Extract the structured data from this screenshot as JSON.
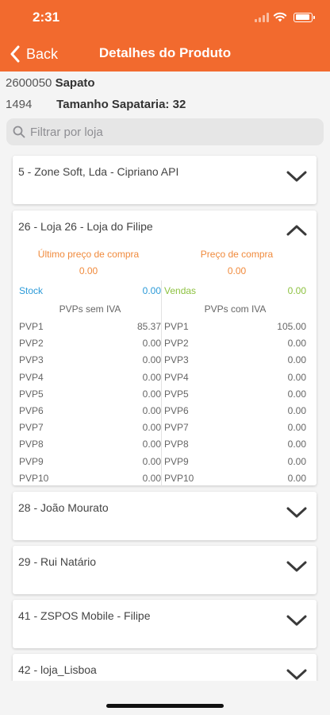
{
  "status": {
    "time": "2:31"
  },
  "nav": {
    "back_label": "Back",
    "title": "Detalhes do Produto"
  },
  "product": {
    "code": "2600050",
    "name": "Sapato",
    "size_code": "1494",
    "size_label": "Tamanho Sapataria: 32"
  },
  "search": {
    "placeholder": "Filtrar por loja"
  },
  "stores": [
    {
      "label": "5 - Zone Soft, Lda - Cipriano API",
      "expanded": false
    },
    {
      "label": "26 - Loja 26 - Loja do Filipe",
      "expanded": true,
      "ultimo_preco_label": "Último preço de compra",
      "ultimo_preco_value": "0.00",
      "preco_compra_label": "Preço de compra",
      "preco_compra_value": "0.00",
      "stock_label": "Stock",
      "stock_value": "0.00",
      "vendas_label": "Vendas",
      "vendas_value": "0.00",
      "pvp_sem_iva_title": "PVPs sem IVA",
      "pvp_com_iva_title": "PVPs com IVA",
      "pvp_sem_iva": [
        {
          "label": "PVP1",
          "value": "85.37"
        },
        {
          "label": "PVP2",
          "value": "0.00"
        },
        {
          "label": "PVP3",
          "value": "0.00"
        },
        {
          "label": "PVP4",
          "value": "0.00"
        },
        {
          "label": "PVP5",
          "value": "0.00"
        },
        {
          "label": "PVP6",
          "value": "0.00"
        },
        {
          "label": "PVP7",
          "value": "0.00"
        },
        {
          "label": "PVP8",
          "value": "0.00"
        },
        {
          "label": "PVP9",
          "value": "0.00"
        },
        {
          "label": "PVP10",
          "value": "0.00"
        }
      ],
      "pvp_com_iva": [
        {
          "label": "PVP1",
          "value": "105.00"
        },
        {
          "label": "PVP2",
          "value": "0.00"
        },
        {
          "label": "PVP3",
          "value": "0.00"
        },
        {
          "label": "PVP4",
          "value": "0.00"
        },
        {
          "label": "PVP5",
          "value": "0.00"
        },
        {
          "label": "PVP6",
          "value": "0.00"
        },
        {
          "label": "PVP7",
          "value": "0.00"
        },
        {
          "label": "PVP8",
          "value": "0.00"
        },
        {
          "label": "PVP9",
          "value": "0.00"
        },
        {
          "label": "PVP10",
          "value": "0.00"
        }
      ]
    },
    {
      "label": "28 - João Mourato",
      "expanded": false
    },
    {
      "label": "29 - Rui Natário",
      "expanded": false
    },
    {
      "label": "41 - ZSPOS Mobile - Filipe",
      "expanded": false
    },
    {
      "label": "42 - loja_Lisboa",
      "expanded": false
    }
  ],
  "colors": {
    "header": "#f26a2e",
    "price_labels": "#f08a3c",
    "stock": "#2b9ad8",
    "vendas": "#8cc13f"
  },
  "icons": [
    "chevron-left-icon",
    "search-icon",
    "chevron-down-icon",
    "chevron-up-icon",
    "signal-icon",
    "wifi-icon",
    "battery-icon"
  ]
}
